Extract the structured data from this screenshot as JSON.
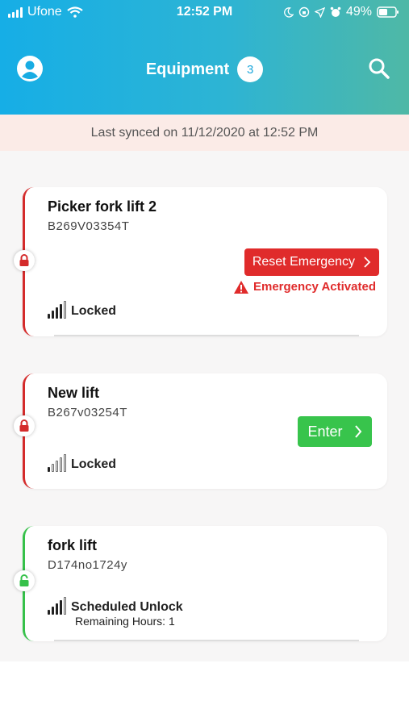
{
  "status_bar": {
    "carrier": "Ufone",
    "time": "12:52 PM",
    "battery": "49%"
  },
  "header": {
    "title": "Equipment",
    "count": "3"
  },
  "sync_text": "Last synced on 11/12/2020 at 12:52 PM",
  "colors": {
    "header_start": "#16aee6",
    "header_end": "#4fb8a6",
    "locked": "#d42b2b",
    "unlocked": "#36c14a",
    "emergency": "#e02b2b",
    "enter": "#38c44c"
  },
  "equipment": [
    {
      "name": "Picker fork lift 2",
      "id": "B269V03354T",
      "lock_icon": "lock-closed-icon",
      "status": "Locked",
      "signal_level": 4,
      "button_label": "Reset Emergency",
      "alert_text": "Emergency Activated"
    },
    {
      "name": "New lift",
      "id": "B267v03254T",
      "lock_icon": "lock-closed-icon",
      "status": "Locked",
      "signal_level": 1,
      "button_label": "Enter"
    },
    {
      "name": "fork lift",
      "id": "D174no1724y",
      "lock_icon": "lock-open-icon",
      "status": "Scheduled Unlock",
      "signal_level": 4,
      "sub_status": "Remaining Hours:  1"
    }
  ]
}
